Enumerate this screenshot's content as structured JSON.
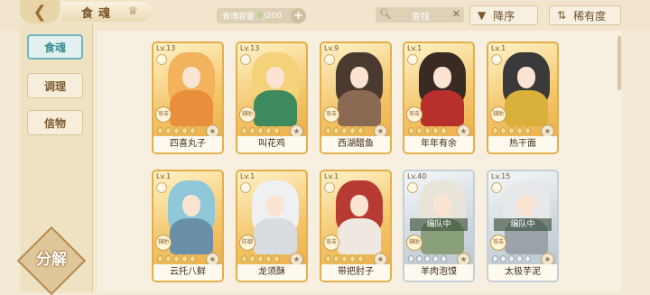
{
  "header": {
    "title": "食魂",
    "capacity_label": "食魂容量",
    "capacity_current": "6",
    "capacity_max": "/200",
    "search_placeholder": "查找",
    "sort_order": "降序",
    "sort_rarity": "稀有度"
  },
  "sidebar": {
    "tabs": [
      {
        "label": "食魂",
        "active": true
      },
      {
        "label": "调理",
        "active": false
      },
      {
        "label": "信物",
        "active": false
      }
    ],
    "decompose_label": "分解"
  },
  "cards": [
    {
      "level": "Lv.13",
      "name": "四喜丸子",
      "role": "攻击",
      "frame": "gold",
      "hair": "#f2b35c",
      "outfit": "#e98f3c"
    },
    {
      "level": "Lv.13",
      "name": "叫花鸡",
      "role": "辅助",
      "frame": "gold",
      "hair": "#f3d27a",
      "outfit": "#3e8a5e"
    },
    {
      "level": "Lv.9",
      "name": "西湖醋鱼",
      "role": "攻击",
      "frame": "gold",
      "hair": "#4a3a30",
      "outfit": "#8a6a52"
    },
    {
      "level": "Lv.1",
      "name": "年年有余",
      "role": "攻击",
      "frame": "gold",
      "hair": "#3a2a24",
      "outfit": "#b8302c"
    },
    {
      "level": "Lv.1",
      "name": "热干面",
      "role": "辅助",
      "frame": "gold",
      "hair": "#3a3a3a",
      "outfit": "#d8b03a"
    },
    {
      "level": "Lv.1",
      "name": "云托八鲜",
      "role": "辅助",
      "frame": "gold",
      "hair": "#8fc8d8",
      "outfit": "#6a8fa8"
    },
    {
      "level": "Lv.1",
      "name": "龙须酥",
      "role": "防御",
      "frame": "gold",
      "hair": "#eef0f2",
      "outfit": "#d8dce0"
    },
    {
      "level": "Lv.1",
      "name": "带把肘子",
      "role": "攻击",
      "frame": "gold",
      "hair": "#b83a34",
      "outfit": "#efe8e0"
    },
    {
      "level": "Lv.40",
      "name": "羊肉泡馍",
      "role": "辅助",
      "frame": "silver",
      "hair": "#e8e4da",
      "outfit": "#8aa07a",
      "team": "编队中"
    },
    {
      "level": "Lv.15",
      "name": "太极芋泥",
      "role": "攻击",
      "frame": "silver",
      "hair": "#e6e8ea",
      "outfit": "#9aa2aa",
      "team": "编队中"
    }
  ]
}
